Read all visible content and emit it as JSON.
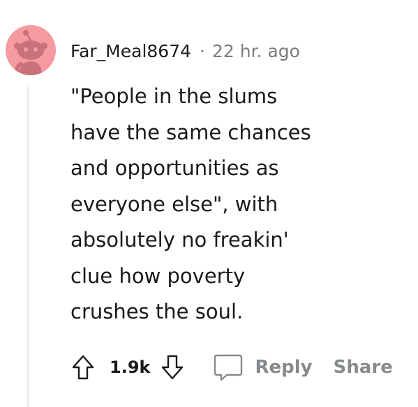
{
  "comment": {
    "username": "Far_Meal8674",
    "separator": "·",
    "timestamp": "22 hr. ago",
    "body": "\"People in the slums\nhave the same chances\nand opportunities as\neveryone else\", with\nabsolutely no freakin'\nclue how poverty\ncrushes the soul.",
    "score": "1.9k",
    "reply_label": "Reply",
    "share_label": "Share"
  },
  "icons": {
    "avatar": "reddit-snoo-avatar",
    "upvote": "arrow-up-outline-icon",
    "downvote": "arrow-down-outline-icon",
    "reply": "speech-bubble-icon"
  },
  "colors": {
    "avatar_bg": "#f59aa0",
    "avatar_figure": "#c8727a",
    "muted_text": "#7c7c7c",
    "action_text": "#878a8c",
    "thread_line": "#edeff1"
  }
}
